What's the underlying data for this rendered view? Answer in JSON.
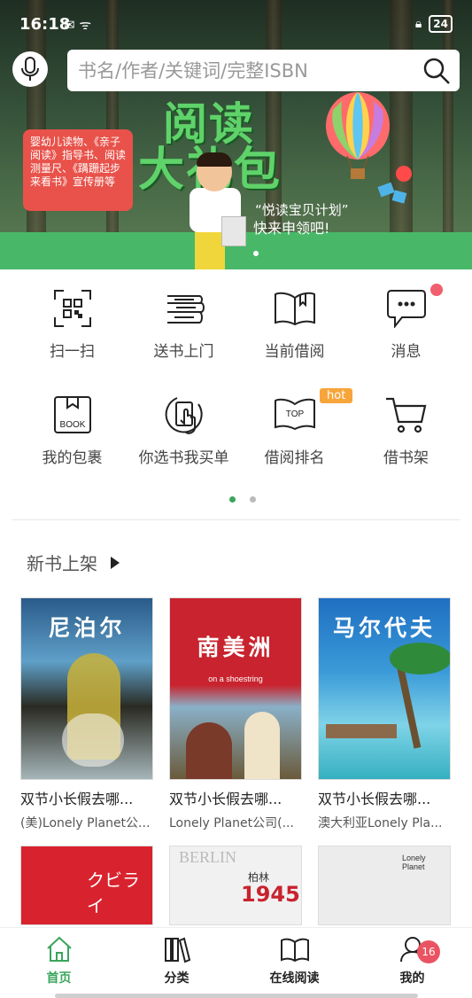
{
  "status": {
    "time": "16:18",
    "battery": "24"
  },
  "search": {
    "placeholder": "书名/作者/关键词/完整ISBN"
  },
  "banner": {
    "bubble_text": "婴幼儿读物、《亲子阅读》指导书、阅读测量尺、《蹒跚起步来看书》宣传册等",
    "title_line1": "阅读",
    "title_line2": "大礼包",
    "subtitle": "“悦读宝贝计划”",
    "cta": "快来申领吧!"
  },
  "quick": [
    {
      "label": "扫一扫",
      "icon": "qr-scan-icon"
    },
    {
      "label": "送书上门",
      "icon": "book-stack-icon"
    },
    {
      "label": "当前借阅",
      "icon": "open-book-icon"
    },
    {
      "label": "消息",
      "icon": "chat-bubble-icon"
    },
    {
      "label": "我的包裹",
      "icon": "package-book-icon"
    },
    {
      "label": "你选书我买单",
      "icon": "tap-hand-icon"
    },
    {
      "label": "借阅排名",
      "icon": "top-book-icon"
    },
    {
      "label": "借书架",
      "icon": "cart-icon"
    }
  ],
  "hot_label": "hot",
  "top_text": "TOP",
  "book_text": "BOOK",
  "section": {
    "new_books": "新书上架"
  },
  "books": [
    {
      "cover_title": "尼泊尔",
      "title": "双节小长假去哪...",
      "author": "(美)Lonely Planet公..."
    },
    {
      "cover_title": "南美洲",
      "cover_sub": "on a shoestring",
      "title": "双节小长假去哪...",
      "author": "Lonely Planet公司(..."
    },
    {
      "cover_title": "马尔代夫",
      "title": "双节小长假去哪...",
      "author": "澳大利亚Lonely Pla..."
    }
  ],
  "books_row2": [
    {
      "cover_text": "クビライ"
    },
    {
      "cover_text": "BERLIN",
      "cover_text2": "柏林",
      "cover_year": "1945"
    },
    {
      "cover_text": "Lonely Planet"
    }
  ],
  "tabs": [
    {
      "label": "首页",
      "icon": "home-icon"
    },
    {
      "label": "分类",
      "icon": "category-books-icon"
    },
    {
      "label": "在线阅读",
      "icon": "read-book-icon"
    },
    {
      "label": "我的",
      "icon": "user-icon",
      "badge": "16"
    }
  ],
  "colors": {
    "accent": "#3aa55c",
    "badge": "#ea5462",
    "hot": "#f7a53a"
  }
}
